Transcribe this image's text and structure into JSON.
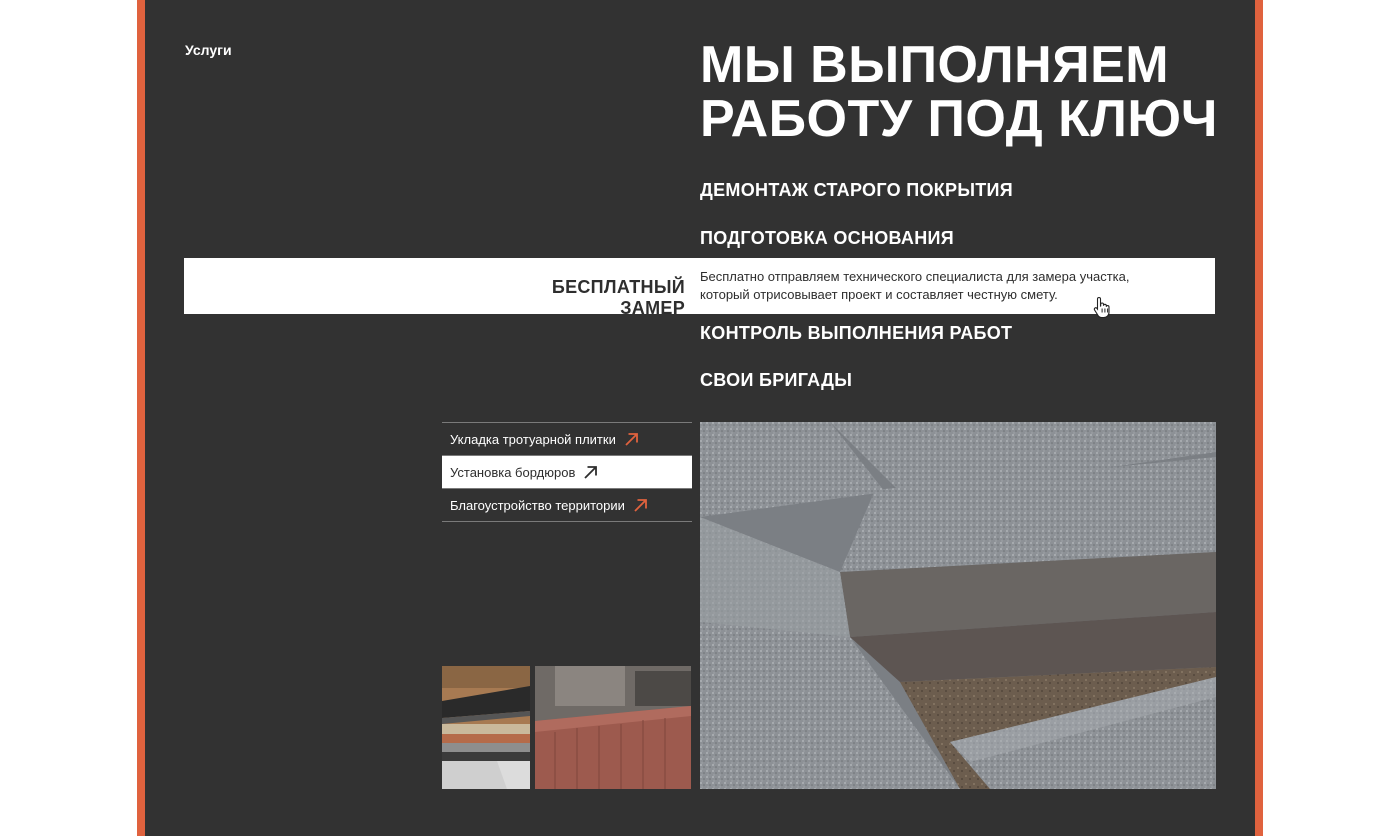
{
  "section": {
    "label": "Услуги"
  },
  "headline": {
    "line1": "МЫ ВЫПОЛНЯЕМ",
    "line2": "РАБОТУ ПОД КЛЮЧ"
  },
  "features": [
    {
      "title": "ДЕМОНТАЖ СТАРОГО ПОКРЫТИЯ"
    },
    {
      "title": "ПОДГОТОВКА ОСНОВАНИЯ"
    },
    {
      "title": "БЕСПЛАТНЫЙ ЗАМЕР",
      "description": "Бесплатно отправляем технического специалиста для замера участка, который отрисовывает проект и составляет честную смету."
    },
    {
      "title": "КОНТРОЛЬ ВЫПОЛНЕНИЯ РАБОТ"
    },
    {
      "title": "СВОИ БРИГАДЫ"
    }
  ],
  "services": [
    {
      "label": "Укладка тротуарной плитки",
      "icon": "arrow-up-right-icon"
    },
    {
      "label": "Установка бордюров",
      "icon": "arrow-up-right-icon"
    },
    {
      "label": "Благоустройство территории",
      "icon": "arrow-up-right-icon"
    }
  ],
  "colors": {
    "accent": "#e0623e",
    "panel": "#323232",
    "text_light": "#ffffff",
    "text_dark": "#2e2e2e"
  }
}
